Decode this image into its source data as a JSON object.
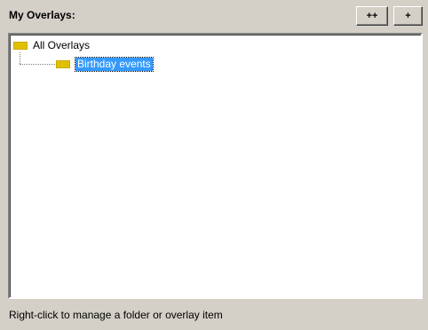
{
  "panel": {
    "title": "My Overlays:",
    "buttons": {
      "add_folder_label": "++",
      "add_item_label": "+"
    }
  },
  "tree": {
    "root": {
      "label": "All Overlays",
      "icon": "folder-icon"
    },
    "children": [
      {
        "label": "Birthday events",
        "icon": "folder-icon",
        "selected": true
      }
    ]
  },
  "status": {
    "text": "Right-click to manage a folder or overlay item"
  },
  "colors": {
    "panel_bg": "#d4d0c8",
    "selection": "#3399ff",
    "folder": "#e0c100"
  }
}
